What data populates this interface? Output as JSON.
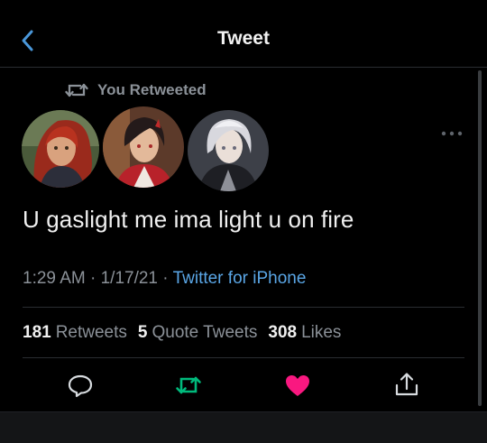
{
  "header": {
    "title": "Tweet"
  },
  "retweet_banner": {
    "text": "You Retweeted"
  },
  "tweet": {
    "text": "U gaslight me ima light u on fire",
    "time": "1:29 AM",
    "date": "1/17/21",
    "separator": "·",
    "source": "Twitter for iPhone"
  },
  "stats": [
    {
      "count": "181",
      "label": "Retweets"
    },
    {
      "count": "5",
      "label": "Quote Tweets"
    },
    {
      "count": "308",
      "label": "Likes"
    }
  ],
  "colors": {
    "accent": "#5aa6e6",
    "retweet_active": "#00ba7c",
    "like_active": "#f91880",
    "muted": "#8b9198"
  },
  "icons": {
    "back": "chevron-left-icon",
    "retweet": "retweet-icon",
    "more": "more-dots-icon",
    "reply": "reply-icon",
    "like": "heart-icon",
    "share": "share-icon"
  }
}
